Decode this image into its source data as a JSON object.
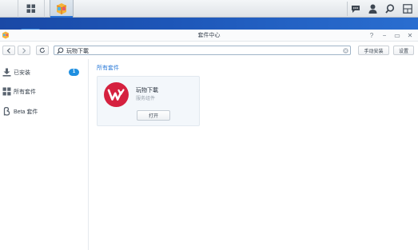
{
  "window": {
    "title": "套件中心",
    "controls": {
      "help": "?",
      "minimize": "−",
      "maximize": "▭",
      "close": "✕"
    }
  },
  "toolbar": {
    "search_value": "玩物下載",
    "manual_install_label": "手动安装",
    "settings_label": "设置"
  },
  "sidebar": {
    "items": [
      {
        "label": "已安装",
        "badge": "1",
        "icon": "download-icon"
      },
      {
        "label": "所有套件",
        "icon": "grid-icon"
      },
      {
        "label": "Beta 套件",
        "icon": "beta-icon"
      }
    ]
  },
  "main": {
    "section_title": "所有套件",
    "packages": [
      {
        "name": "玩物下載",
        "subtitle": "服务组件",
        "action_label": "打开",
        "icon": "wondershare-logo"
      }
    ]
  },
  "colors": {
    "accent": "#2a7ad8",
    "badge": "#1f8fe0",
    "logo": "#d5213f",
    "desktop": "#1d56b8"
  }
}
